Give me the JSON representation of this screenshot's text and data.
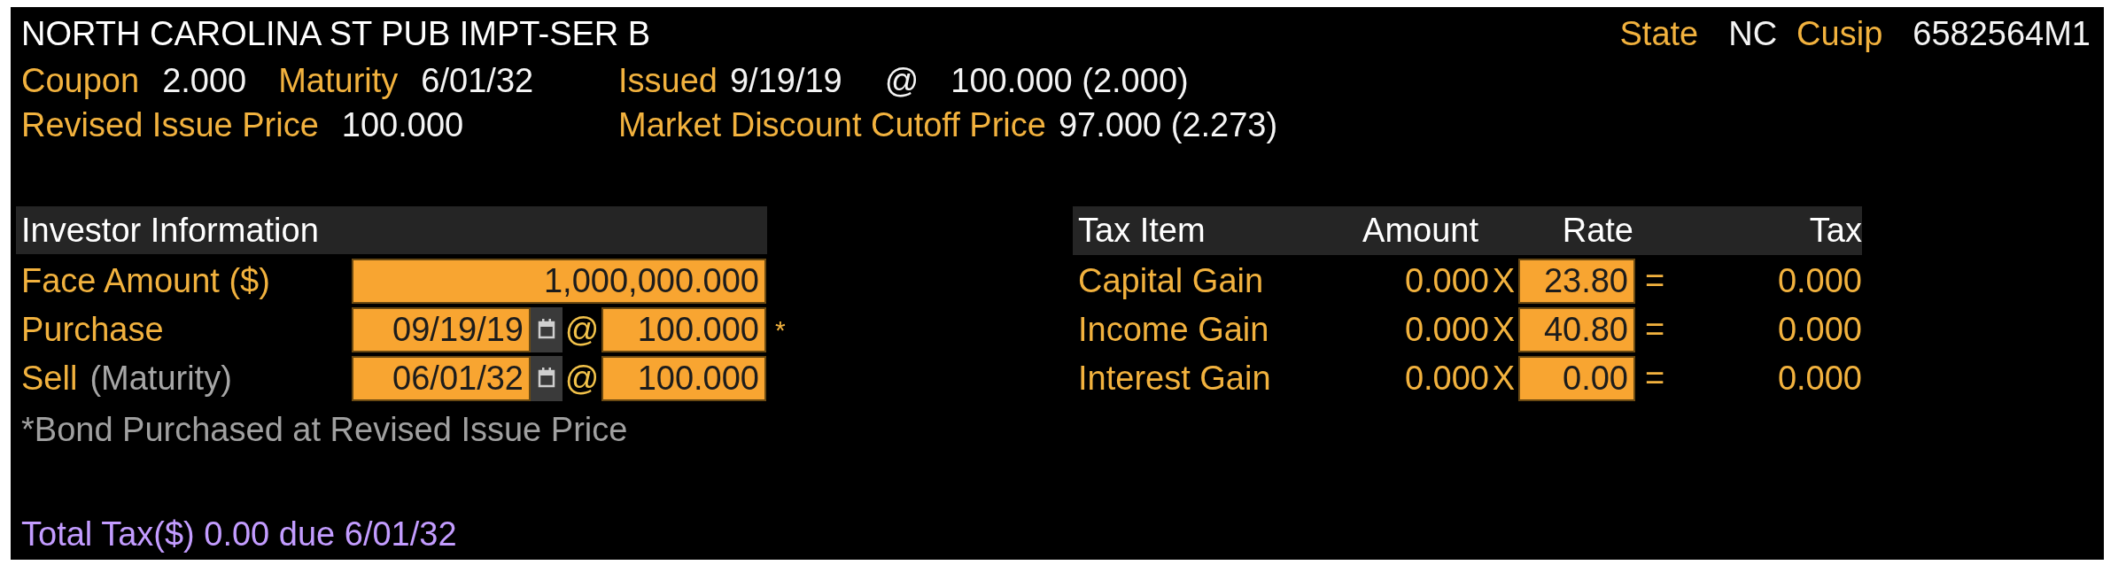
{
  "header": {
    "title": "NORTH CAROLINA ST PUB IMPT-SER B",
    "identifiers": [
      {
        "label": "State",
        "value": "NC"
      },
      {
        "label": "Cusip",
        "value": "6582564M1"
      }
    ]
  },
  "terms": [
    {
      "left": [
        {
          "label": "Coupon",
          "value": "2.000"
        },
        {
          "label": "Maturity",
          "value": "6/01/32"
        }
      ],
      "right": {
        "label": "Issued",
        "value": "9/19/19",
        "at": "@",
        "price": "100.000 (2.000)"
      }
    },
    {
      "left": [
        {
          "label": "Revised Issue Price",
          "value": "100.000"
        }
      ],
      "right": {
        "label": "Market Discount Cutoff Price",
        "value": "97.000 (2.273)"
      }
    }
  ],
  "investor": {
    "title": "Investor Information",
    "rows": [
      {
        "kind": "amount",
        "label": "Face Amount ($)",
        "value": "1,000,000.000"
      },
      {
        "kind": "trade",
        "label": "Purchase",
        "date": "09/19/19",
        "at": "@",
        "price": "100.000",
        "flag": "*"
      },
      {
        "kind": "trade",
        "label": "Sell",
        "note": "(Maturity)",
        "date": "06/01/32",
        "at": "@",
        "price": "100.000"
      }
    ],
    "footnote": "*Bond Purchased at Revised Issue Price"
  },
  "tax_table": {
    "columns": [
      "Tax Item",
      "Amount",
      "Rate",
      "Tax"
    ],
    "rows": [
      {
        "item": "Capital Gain",
        "amount": "0.000",
        "times": "X",
        "rate": "23.80",
        "equals": "=",
        "tax": "0.000"
      },
      {
        "item": "Income Gain",
        "amount": "0.000",
        "times": "X",
        "rate": "40.80",
        "equals": "=",
        "tax": "0.000"
      },
      {
        "item": "Interest Gain",
        "amount": "0.000",
        "times": "X",
        "rate": "0.00",
        "equals": "=",
        "tax": "0.000"
      }
    ]
  },
  "total": "Total Tax($) 0.00 due 6/01/32"
}
